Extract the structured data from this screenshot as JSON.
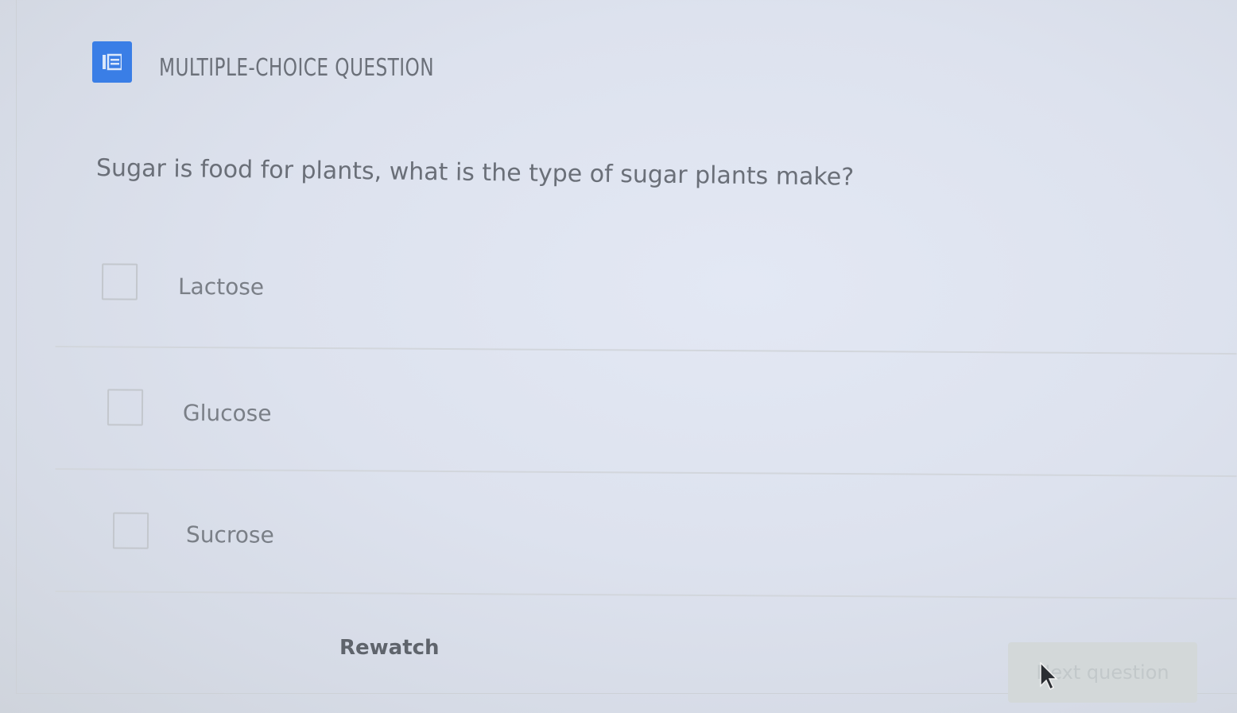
{
  "question_type": {
    "title": "MULTIPLE-CHOICE QUESTION",
    "icon": "list-icon",
    "badge_color": "#3a7ee6"
  },
  "question": {
    "text": "Sugar is food for plants, what is the type of sugar plants make?"
  },
  "options": [
    {
      "label": "Lactose",
      "checked": false
    },
    {
      "label": "Glucose",
      "checked": false
    },
    {
      "label": "Sucrose",
      "checked": false
    }
  ],
  "actions": {
    "rewatch_label": "Rewatch",
    "next_label": "Next question",
    "next_enabled": false
  }
}
